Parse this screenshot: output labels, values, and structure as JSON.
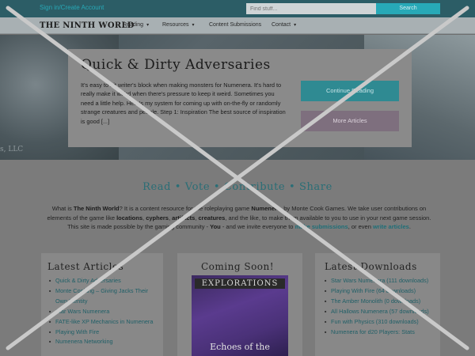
{
  "topbar": {
    "signin_label": "Sign in/Create Account",
    "search_placeholder": "Find stuff...",
    "search_button": "Search"
  },
  "nav": {
    "logo": "THE NINTH WORLD",
    "items": [
      {
        "label": "Reading",
        "caret": "▾"
      },
      {
        "label": "Resources",
        "caret": "▾"
      },
      {
        "label": "Content Submissions"
      },
      {
        "label": "Contact",
        "caret": "▾"
      }
    ]
  },
  "hero": {
    "caption": "s, LLC",
    "feature": {
      "title": "Quick & Dirty Adversaries",
      "text": "It's easy to hit writer's block when making monsters for Numenera. It's hard to really make it weird when there's pressure to keep it weird. Sometimes you need a little help. Here's my system for coming up with on-the-fly or randomly strange creatures and people. Step 1: Inspiration The best source of inspiration is good [...]",
      "continue_label": "Continue Reading",
      "more_label": "More Articles"
    }
  },
  "main": {
    "tagline": "Read • Vote • Contribute • Share",
    "intro": {
      "p1": "What is ",
      "site": "The Ninth World",
      "p2": "? It is a content resource for the roleplaying game ",
      "game": "Numenera",
      "p3": ", by Monte Cook Games. We take user contributions on elements of the game like ",
      "t1": "locations",
      "t2": "cyphers",
      "t3": "artifacts",
      "t4": "creatures",
      "p4": ", and the like, to make them available to you to use in your next game session. This site is made possible by the gaming community - ",
      "you": "You",
      "p5": " - and we invite everyone to ",
      "link1": "make submissions",
      "p6": ", or even ",
      "link2": "write articles",
      "p7": "."
    },
    "latest_articles": {
      "title": "Latest Articles",
      "items": [
        "Quick & Dirty Adversaries",
        "Monte Cooking – Giving Jacks Their Own Identity",
        "Star Wars Numenera",
        "FATE-like XP Mechanics in Numenera",
        "Playing With Fire",
        "Numenera Networking"
      ]
    },
    "coming_soon": {
      "title": "Coming Soon!",
      "cover_title": "EXPLORATIONS",
      "cover_subtitle": "Echoes of the"
    },
    "latest_downloads": {
      "title": "Latest Downloads",
      "items": [
        "Star Wars Numenera (111 downloads)",
        "Playing With Fire (64 downloads)",
        "The Amber Monolith (0 downloads)",
        "All Hallows Numenera (57 downloads)",
        "Fun with Physics (310 downloads)",
        "Numenera for d20 Players: Stats"
      ]
    }
  },
  "colors": {
    "accent": "#27a9b7",
    "tagline": "#2a6e76",
    "continue": "#2f8a92",
    "more": "#7e6f7e"
  }
}
